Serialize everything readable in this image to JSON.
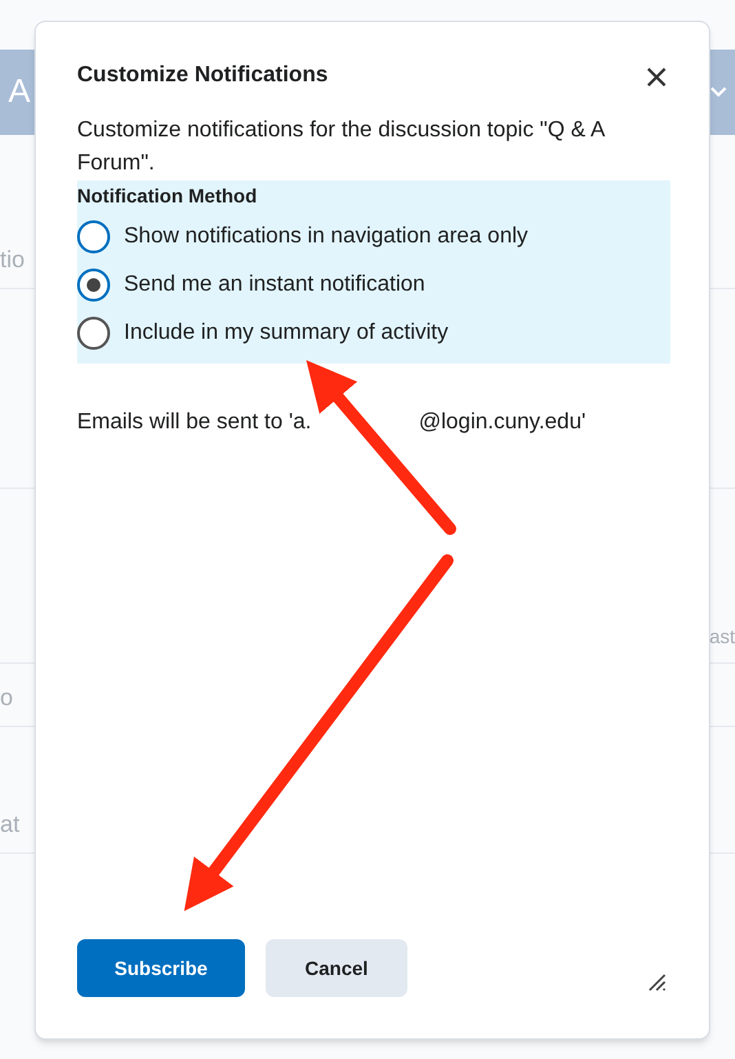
{
  "background": {
    "header_text": "A",
    "rows": [
      {
        "left": "tio",
        "right": ""
      },
      {
        "left": "",
        "right": ""
      },
      {
        "left": "",
        "right": "ast"
      },
      {
        "left": "o",
        "right": ""
      },
      {
        "left": "at",
        "right": ""
      }
    ]
  },
  "dialog": {
    "title": "Customize Notifications",
    "description": "Customize notifications for the discussion topic \"Q & A Forum\".",
    "legend": "Notification Method",
    "options": [
      {
        "label": "Show notifications in navigation area only",
        "selected": false
      },
      {
        "label": "Send me an instant notification",
        "selected": true
      },
      {
        "label": "Include in my summary of activity",
        "selected": false
      }
    ],
    "email_prefix": "Emails will be sent to 'a.",
    "email_suffix": "@login.cuny.edu'",
    "buttons": [
      {
        "label": "Subscribe",
        "kind": "primary"
      },
      {
        "label": "Cancel",
        "kind": "secondary"
      }
    ]
  }
}
